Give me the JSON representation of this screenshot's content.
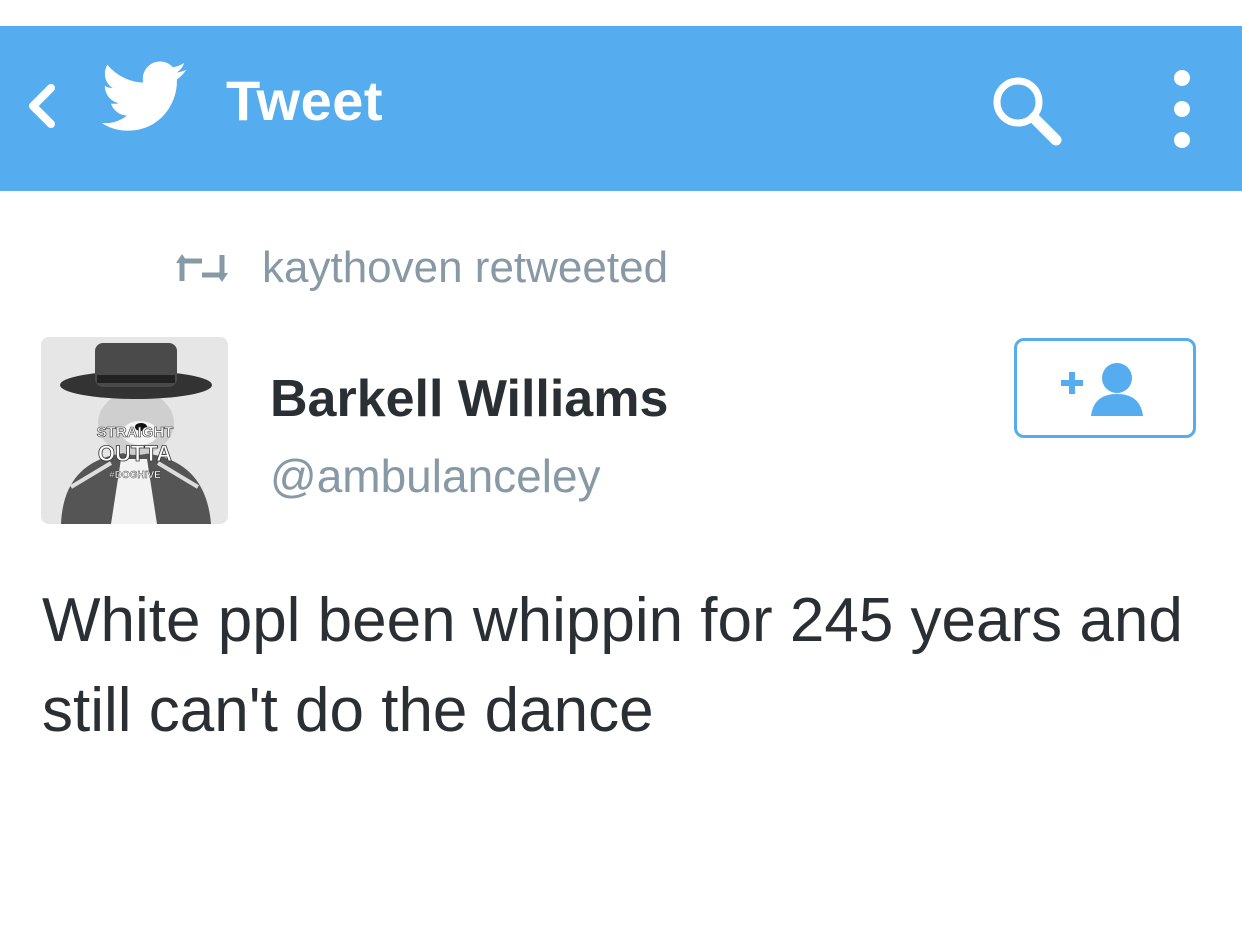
{
  "appbar": {
    "title": "Tweet",
    "background_color": "#55acee",
    "icons": {
      "back": "chevron-left-icon",
      "logo": "twitter-bird-icon",
      "search": "search-icon",
      "more": "overflow-menu-icon"
    }
  },
  "retweet": {
    "text": "kaythoven retweeted",
    "icon": "retweet-icon"
  },
  "author": {
    "display_name": "Barkell Williams",
    "handle": "@ambulanceley",
    "avatar_caption": [
      "STRAIGHT",
      "OUTTA",
      "#DOGHIVE"
    ]
  },
  "follow": {
    "icon": "add-user-icon",
    "accent_color": "#55acee"
  },
  "tweet": {
    "text": "White ppl been whippin for 245 years and still can't do the dance"
  }
}
